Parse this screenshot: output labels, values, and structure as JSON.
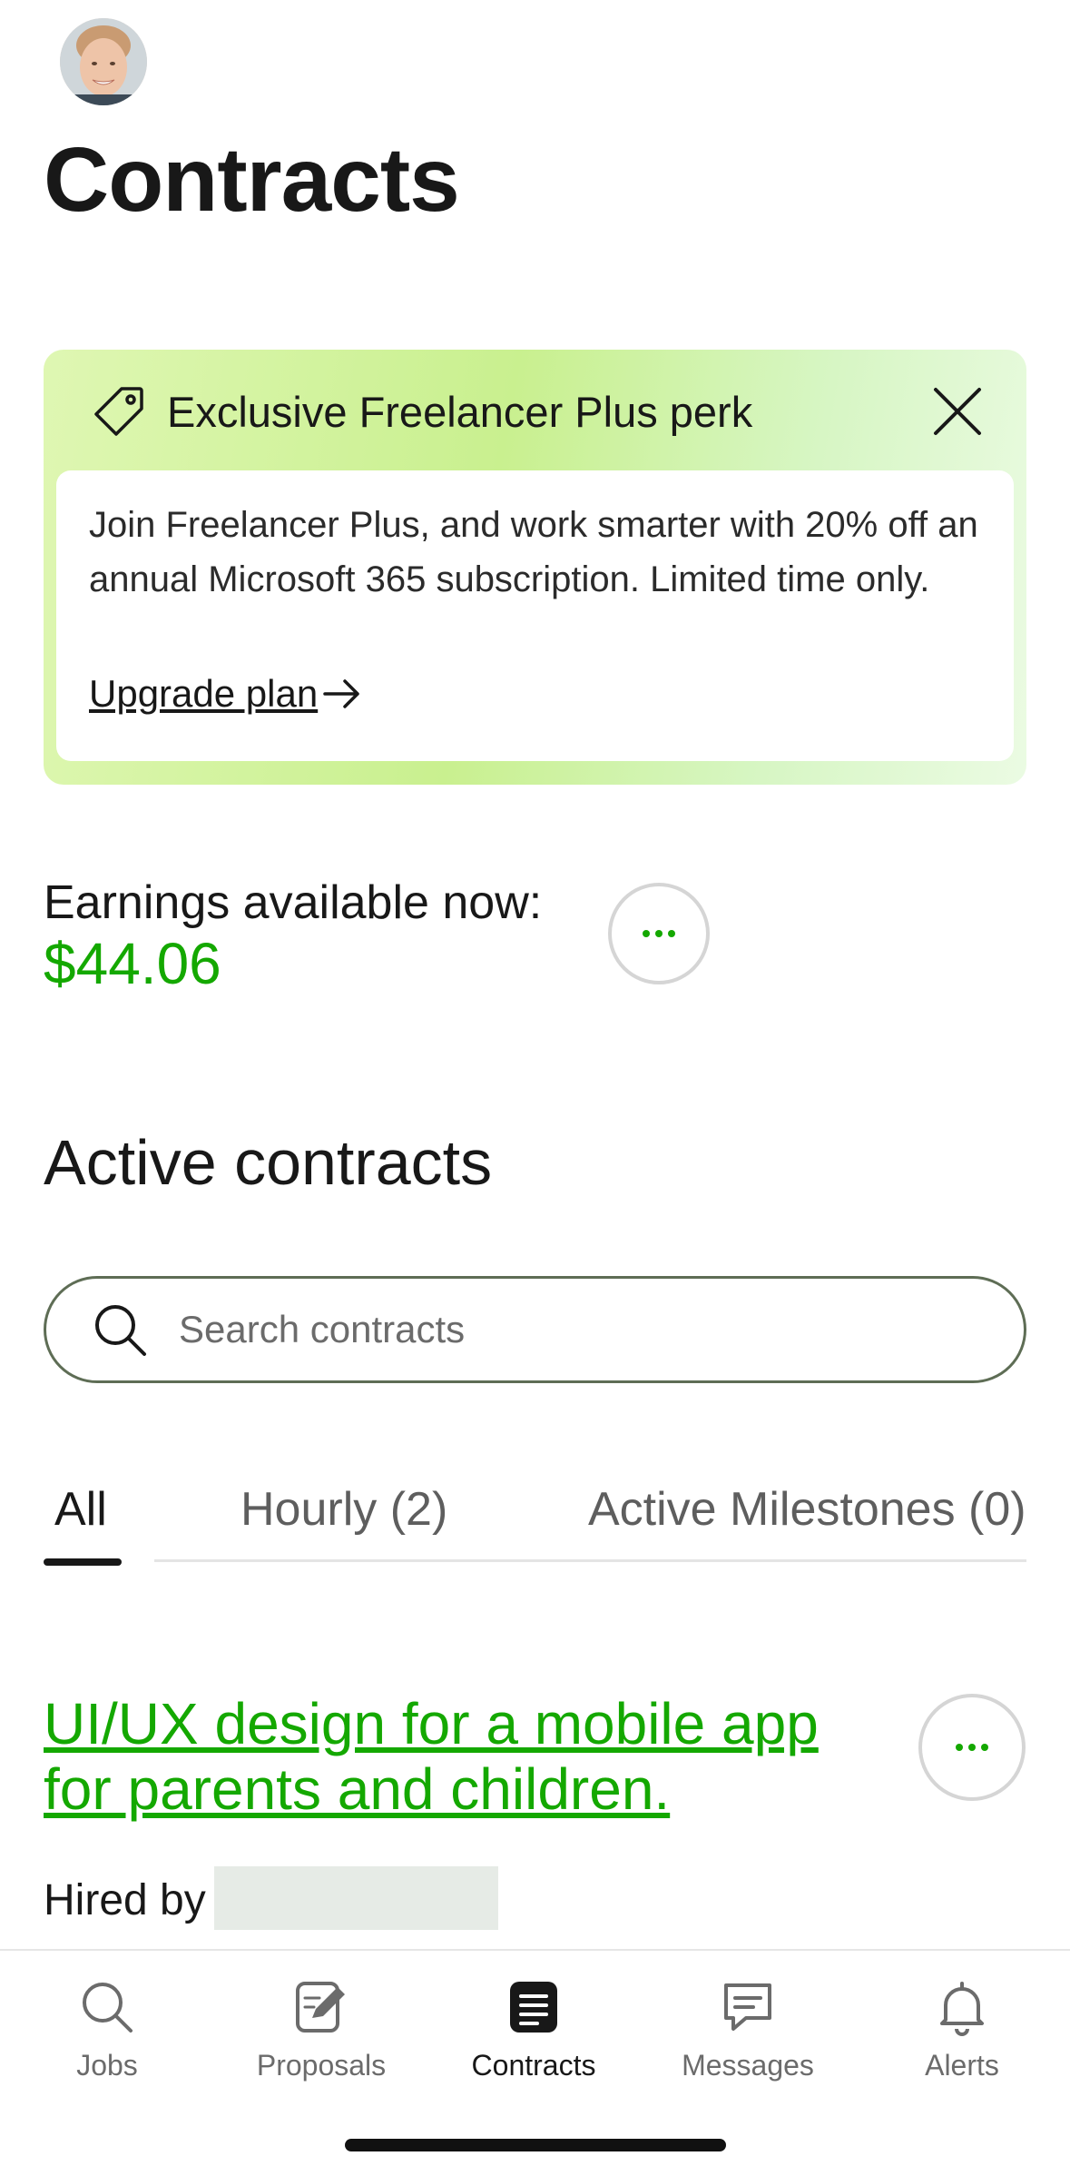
{
  "header": {
    "title": "Contracts",
    "avatar_icon": "user-avatar"
  },
  "promo": {
    "title": "Exclusive Freelancer Plus perk",
    "body": "Join Freelancer Plus, and work smarter with 20% off an annual Microsoft 365 subscription. Limited time only.",
    "link": "Upgrade plan",
    "icon": "tag-icon",
    "close_icon": "close-icon"
  },
  "earnings": {
    "label": "Earnings available now:",
    "value": "$44.06"
  },
  "active_contracts": {
    "title": "Active contracts",
    "search_placeholder": "Search contracts",
    "tabs": [
      {
        "label": "All",
        "active": true
      },
      {
        "label": "Hourly (2)",
        "active": false
      },
      {
        "label": "Active Milestones (0)",
        "active": false
      }
    ],
    "items": [
      {
        "title": "UI/UX design for a mobile app for parents and children.",
        "hired_by_label": "Hired by"
      }
    ]
  },
  "bottom_nav": [
    {
      "label": "Jobs",
      "icon": "search-icon",
      "active": false
    },
    {
      "label": "Proposals",
      "icon": "proposal-edit-icon",
      "active": false
    },
    {
      "label": "Contracts",
      "icon": "contracts-icon",
      "active": true
    },
    {
      "label": "Messages",
      "icon": "chat-icon",
      "active": false
    },
    {
      "label": "Alerts",
      "icon": "bell-icon",
      "active": false
    }
  ],
  "colors": {
    "accent": "#14a800",
    "text": "#181818",
    "muted": "#6b6b6b"
  }
}
